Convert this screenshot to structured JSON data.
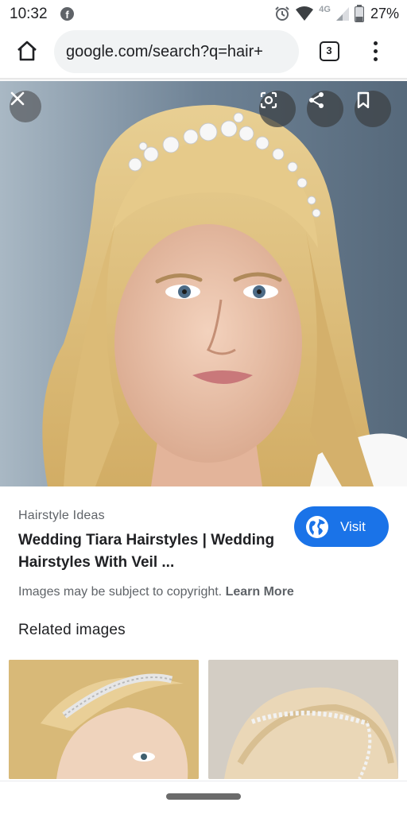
{
  "status_bar": {
    "time": "10:32",
    "network_label": "4G",
    "battery_percent": "27%",
    "icons": [
      "facebook-icon",
      "alarm-icon",
      "wifi-icon",
      "signal-icon",
      "battery-icon"
    ]
  },
  "browser": {
    "url": "google.com/search?q=hair+",
    "tab_count": "3"
  },
  "image_viewer": {
    "image_description": "woman with blonde hair wearing a jeweled tiara",
    "buttons": [
      "close-icon",
      "lens-icon",
      "share-icon",
      "bookmark-icon"
    ]
  },
  "result": {
    "source": "Hairstyle Ideas",
    "title": "Wedding Tiara Hairstyles | Wedding Hairstyles With Veil ...",
    "visit_label": "Visit",
    "copyright_text": "Images may be subject to copyright.",
    "learn_more": "Learn More"
  },
  "related": {
    "heading": "Related images"
  },
  "colors": {
    "accent": "#1a73e8",
    "text_primary": "#202124",
    "text_secondary": "#5f6368"
  }
}
